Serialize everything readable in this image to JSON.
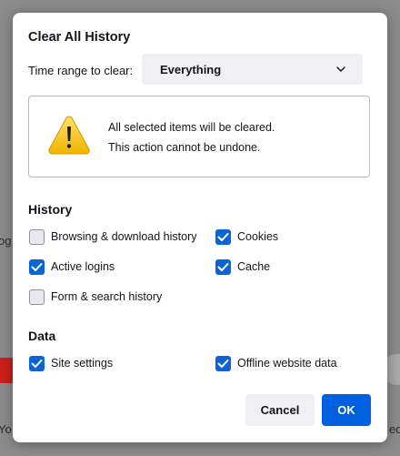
{
  "background": {
    "fragments": [
      "og",
      "Yo",
      "ed"
    ]
  },
  "dialog": {
    "title": "Clear All History",
    "time_range": {
      "label": "Time range to clear:",
      "value": "Everything",
      "chevron_icon": "chevron-down-icon"
    },
    "warning": {
      "icon": "warning-triangle-icon",
      "line1": "All selected items will be cleared.",
      "line2": "This action cannot be undone."
    },
    "history": {
      "title": "History",
      "options": [
        {
          "label": "Browsing & download history",
          "checked": false
        },
        {
          "label": "Cookies",
          "checked": true
        },
        {
          "label": "Active logins",
          "checked": true
        },
        {
          "label": "Cache",
          "checked": true
        },
        {
          "label": "Form & search history",
          "checked": false
        }
      ]
    },
    "data": {
      "title": "Data",
      "options": [
        {
          "label": "Site settings",
          "checked": true
        },
        {
          "label": "Offline website data",
          "checked": true
        }
      ]
    },
    "buttons": {
      "cancel": "Cancel",
      "ok": "OK"
    }
  },
  "colors": {
    "accent": "#0061e0",
    "checkbox_checked": "#0a64d8",
    "warning_yellow": "#f4c430"
  }
}
